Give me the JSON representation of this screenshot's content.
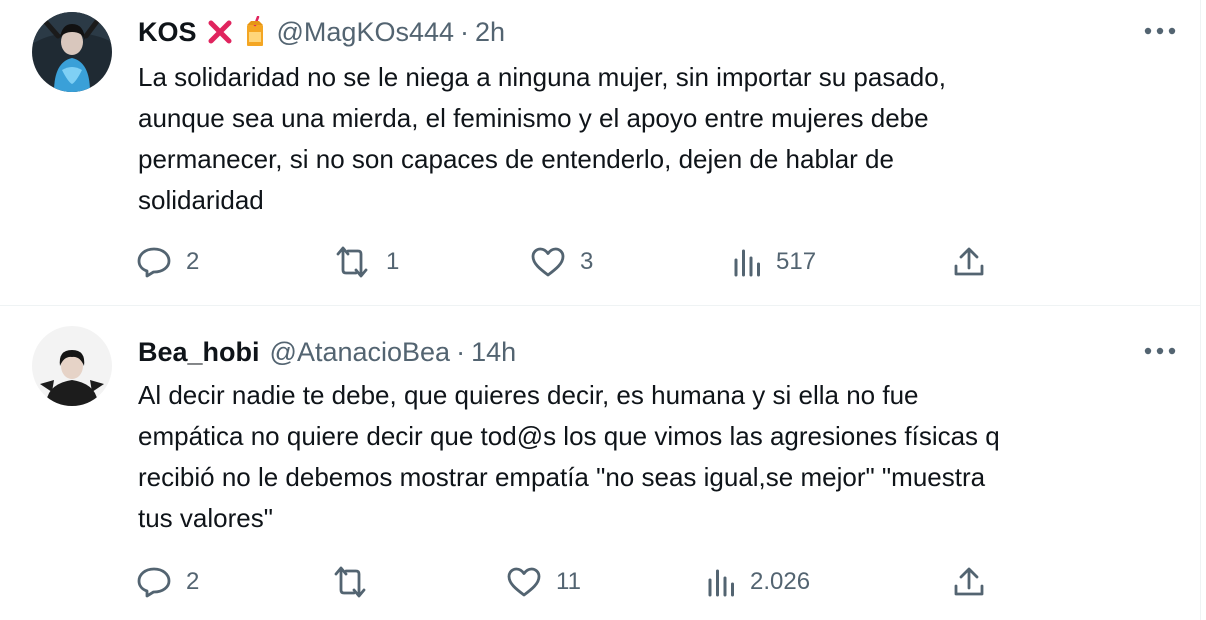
{
  "tweets": [
    {
      "display_name": "KOS",
      "badges": [
        "cross-mark-emoji",
        "beverage-box-emoji"
      ],
      "handle": "@MagKOs444",
      "separator": "·",
      "time": "2h",
      "text_lines": [
        "La solidaridad no se le niega a ninguna mujer, sin importar su pasado,",
        "aunque sea una mierda, el feminismo y el apoyo entre mujeres debe",
        "permanecer, si no son capaces de entenderlo, dejen de hablar de",
        "solidaridad"
      ],
      "replies": "2",
      "retweets": "1",
      "likes": "3",
      "views": "517",
      "icons": [
        "reply-icon",
        "retweet-icon",
        "like-icon",
        "views-icon",
        "share-icon",
        "more-icon"
      ]
    },
    {
      "display_name": "Bea_hobi",
      "handle": "@AtanacioBea",
      "separator": "·",
      "time": "14h",
      "text_lines": [
        "Al decir nadie te debe, que quieres decir, es humana y si ella no fue",
        "empática no quiere decir que tod@s los que vimos las agresiones físicas q",
        "recibió no le debemos mostrar empatía \"no seas igual,se mejor\" \"muestra",
        "tus valores\""
      ],
      "replies": "2",
      "retweets": "",
      "likes": "11",
      "views": "2.026",
      "icons": [
        "reply-icon",
        "retweet-icon",
        "like-icon",
        "views-icon",
        "share-icon",
        "more-icon"
      ]
    }
  ],
  "colors": {
    "text_primary": "#0f1419",
    "text_secondary": "#536471",
    "divider": "#eff3f4",
    "cross_mark": "#e0245e"
  }
}
